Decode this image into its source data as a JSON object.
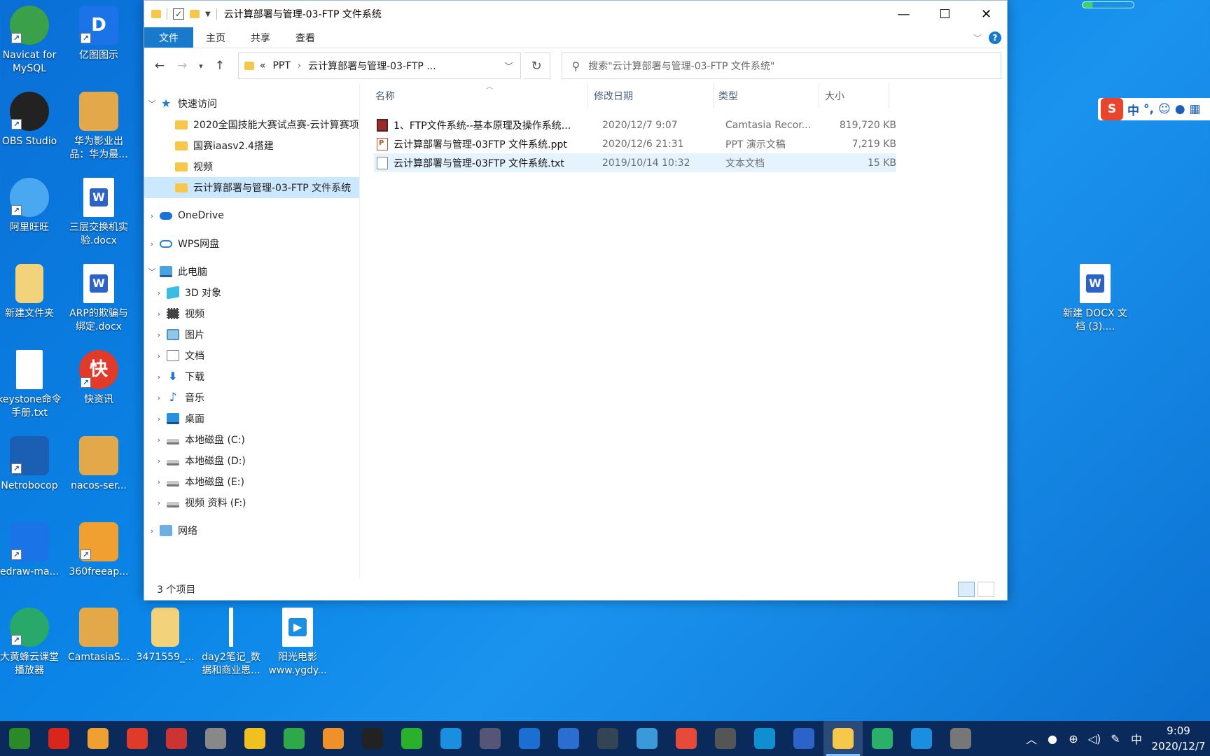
{
  "window": {
    "title": "云计算部署与管理-03-FTP 文件系统",
    "ribbon_tabs": [
      "文件",
      "主页",
      "共享",
      "查看"
    ],
    "address": {
      "prefix": "«",
      "crumbs": [
        "PPT",
        "云计算部署与管理-03-FTP ..."
      ]
    },
    "search_placeholder": "搜索\"云计算部署与管理-03-FTP 文件系统\"",
    "nav": {
      "quick_access": "快速访问",
      "quick_items": [
        "2020全国技能大赛试点赛-云计算赛项",
        "国赛iaasv2.4搭建",
        "视频",
        "云计算部署与管理-03-FTP 文件系统"
      ],
      "onedrive": "OneDrive",
      "wps": "WPS网盘",
      "this_pc": "此电脑",
      "pc_items": [
        "3D 对象",
        "视频",
        "图片",
        "文档",
        "下载",
        "音乐",
        "桌面",
        "本地磁盘 (C:)",
        "本地磁盘 (D:)",
        "本地磁盘 (E:)",
        "视频 资料 (F:)"
      ],
      "network": "网络"
    },
    "columns": {
      "name": "名称",
      "date": "修改日期",
      "type": "类型",
      "size": "大小"
    },
    "files": [
      {
        "name": "1、FTP文件系统--基本原理及操作系统...",
        "date": "2020/12/7 9:07",
        "type": "Camtasia Recor...",
        "size": "819,720 KB",
        "icon": "camtasia-icon"
      },
      {
        "name": "云计算部署与管理-03FTP 文件系统.ppt",
        "date": "2020/12/6 21:31",
        "type": "PPT 演示文稿",
        "size": "7,219 KB",
        "icon": "ppt-icon"
      },
      {
        "name": "云计算部署与管理-03FTP 文件系统.txt",
        "date": "2019/10/14 10:32",
        "type": "文本文档",
        "size": "15 KB",
        "icon": "txt-icon"
      }
    ],
    "status": "3 个项目"
  },
  "desktop": {
    "icons": [
      {
        "label": "Navicat for MySQL",
        "color": "#3aa14a"
      },
      {
        "label": "亿图图示",
        "color": "#1b73e8"
      },
      {
        "label": "OBS Studio",
        "color": "#222222"
      },
      {
        "label": "华为影业出品：华为最...",
        "color": "#e2a84a"
      },
      {
        "label": "阿里旺旺",
        "color": "#4aa8f0"
      },
      {
        "label": "三层交换机实验.docx",
        "color": "#ffffff"
      },
      {
        "label": "新建文件夹",
        "color": "#f2d27a"
      },
      {
        "label": "ARP的欺骗与绑定.docx",
        "color": "#ffffff"
      },
      {
        "label": "keystone命令手册.txt",
        "color": "#ffffff"
      },
      {
        "label": "快资讯",
        "color": "#e03a2a"
      },
      {
        "label": "Netrobocop",
        "color": "#1a5fb4"
      },
      {
        "label": "nacos-ser...",
        "color": "#e2a84a"
      },
      {
        "label": "edraw-ma...",
        "color": "#1b73e8"
      },
      {
        "label": "360freeap...",
        "color": "#f0a030"
      },
      {
        "label": "大黄蜂云课堂播放器",
        "color": "#28a86a"
      },
      {
        "label": "CamtasiaS...",
        "color": "#e2a84a"
      },
      {
        "label": "3471559_...",
        "color": "#f2d27a"
      },
      {
        "label": "day2笔记_数据和商业思...",
        "color": "#ffffff"
      },
      {
        "label": "阳光电影www.ygdy...",
        "color": "#ffffff"
      },
      {
        "label": "新建 DOCX 文档 (3)....",
        "color": "#ffffff"
      }
    ]
  },
  "ime": {
    "logo": "S",
    "mode": "中"
  },
  "taskbar": {
    "clock_time": "9:09",
    "clock_date": "2020/12/7",
    "tray_lang": "中",
    "apps": [
      "#2a8a2a",
      "#d8261c",
      "#f0a030",
      "#e03a2a",
      "#c33",
      "#888",
      "#f0c020",
      "#2fa84a",
      "#f0902a",
      "#222",
      "#2bb02b",
      "#1a8fe0",
      "#557",
      "#1a6fd0",
      "#2a6fd0",
      "#345",
      "#3a9ad9",
      "#e84a3a",
      "#555",
      "#0f8fd0",
      "#2b63c8",
      "#f5c84c",
      "#2bb06a",
      "#1a8fe0",
      "#777"
    ]
  }
}
